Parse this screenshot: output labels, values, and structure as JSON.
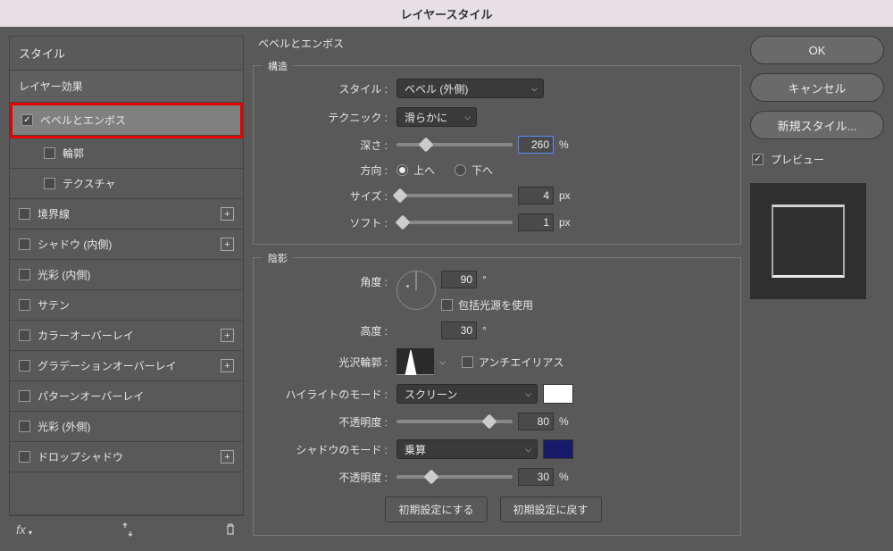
{
  "title": "レイヤースタイル",
  "sidebar": {
    "styles_label": "スタイル",
    "layer_effects": "レイヤー効果",
    "items": [
      {
        "label": "ベベルとエンボス",
        "checked": true,
        "selected": true,
        "highlighted": true
      },
      {
        "label": "輪郭",
        "checked": false,
        "indent": true
      },
      {
        "label": "テクスチャ",
        "checked": false,
        "indent": true
      },
      {
        "label": "境界線",
        "checked": false,
        "add": true
      },
      {
        "label": "シャドウ (内側)",
        "checked": false,
        "add": true
      },
      {
        "label": "光彩 (内側)",
        "checked": false
      },
      {
        "label": "サテン",
        "checked": false
      },
      {
        "label": "カラーオーバーレイ",
        "checked": false,
        "add": true
      },
      {
        "label": "グラデーションオーバーレイ",
        "checked": false,
        "add": true
      },
      {
        "label": "パターンオーバーレイ",
        "checked": false
      },
      {
        "label": "光彩 (外側)",
        "checked": false
      },
      {
        "label": "ドロップシャドウ",
        "checked": false,
        "add": true
      }
    ]
  },
  "panel_title": "ベベルとエンボス",
  "structure": {
    "legend": "構造",
    "style_label": "スタイル :",
    "style_value": "ベベル (外側)",
    "technique_label": "テクニック :",
    "technique_value": "滑らかに",
    "depth_label": "深さ :",
    "depth_value": "260",
    "depth_unit": "%",
    "direction_label": "方向 :",
    "direction_up": "上へ",
    "direction_down": "下へ",
    "size_label": "サイズ :",
    "size_value": "4",
    "size_unit": "px",
    "soften_label": "ソフト :",
    "soften_value": "1",
    "soften_unit": "px"
  },
  "shading": {
    "legend": "陰影",
    "angle_label": "角度 :",
    "angle_value": "90",
    "angle_unit": "°",
    "global_light_label": "包括光源を使用",
    "altitude_label": "高度 :",
    "altitude_value": "30",
    "altitude_unit": "°",
    "contour_label": "光沢輪郭 :",
    "antialias_label": "アンチエイリアス",
    "highlight_mode_label": "ハイライトのモード :",
    "highlight_mode_value": "スクリーン",
    "highlight_opacity_label": "不透明度 :",
    "highlight_opacity_value": "80",
    "highlight_opacity_unit": "%",
    "shadow_mode_label": "シャドウのモード :",
    "shadow_mode_value": "乗算",
    "shadow_opacity_label": "不透明度 :",
    "shadow_opacity_value": "30",
    "shadow_opacity_unit": "%"
  },
  "buttons": {
    "make_default": "初期設定にする",
    "reset_default": "初期設定に戻す"
  },
  "right": {
    "ok": "OK",
    "cancel": "キャンセル",
    "new_style": "新規スタイル...",
    "preview_label": "プレビュー"
  }
}
